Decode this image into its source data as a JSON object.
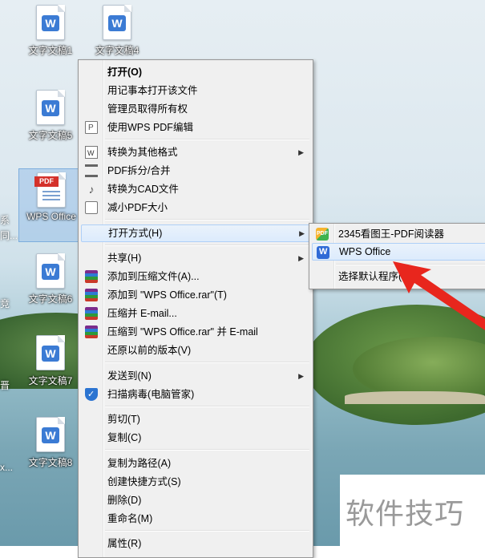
{
  "desktop": {
    "icons": [
      {
        "label": "文字文稿1"
      },
      {
        "label": "文字文稿4"
      },
      {
        "label": "文字文稿5"
      },
      {
        "label": "WPS Office"
      },
      {
        "label": "文字文稿6"
      },
      {
        "label": "文字文稿7"
      },
      {
        "label": "文字文稿8"
      }
    ],
    "edge_texts": [
      "系",
      "同...",
      "竞",
      "晋",
      "x..."
    ]
  },
  "context_menu": {
    "items": [
      {
        "label": "打开(O)",
        "bold": true
      },
      {
        "label": "用记事本打开该文件"
      },
      {
        "label": "管理员取得所有权"
      },
      {
        "label": "使用WPS PDF编辑",
        "icon": "pdf-edit-icon"
      },
      {
        "label": "转换为其他格式",
        "icon": "convert-icon",
        "submenu": true
      },
      {
        "label": "PDF拆分/合并",
        "icon": "split-merge-icon"
      },
      {
        "label": "转换为CAD文件",
        "icon": "cad-icon"
      },
      {
        "label": "减小PDF大小",
        "icon": "shrink-pdf-icon"
      },
      {
        "label": "打开方式(H)",
        "submenu": true,
        "highlighted": true
      },
      {
        "label": "共享(H)",
        "submenu": true
      },
      {
        "label": "添加到压缩文件(A)...",
        "icon": "winrar-icon"
      },
      {
        "label": "添加到 \"WPS Office.rar\"(T)",
        "icon": "winrar-icon"
      },
      {
        "label": "压缩并 E-mail...",
        "icon": "winrar-icon"
      },
      {
        "label": "压缩到 \"WPS Office.rar\" 并 E-mail",
        "icon": "winrar-icon"
      },
      {
        "label": "还原以前的版本(V)"
      },
      {
        "label": "发送到(N)",
        "submenu": true
      },
      {
        "label": "扫描病毒(电脑管家)",
        "icon": "shield-icon"
      },
      {
        "label": "剪切(T)"
      },
      {
        "label": "复制(C)"
      },
      {
        "label": "复制为路径(A)"
      },
      {
        "label": "创建快捷方式(S)"
      },
      {
        "label": "删除(D)"
      },
      {
        "label": "重命名(M)"
      },
      {
        "label": "属性(R)"
      }
    ]
  },
  "open_with_submenu": {
    "items": [
      {
        "label": "2345看图王-PDF阅读器",
        "icon": "2345-viewer-icon"
      },
      {
        "label": "WPS Office",
        "icon": "wps-icon",
        "highlighted": true
      },
      {
        "label": "选择默认程序(C)..."
      }
    ]
  },
  "icon_texts": {
    "pdf_badge": "PDF",
    "word_badge": "W",
    "app_2345": "PDF"
  },
  "watermark": {
    "text": "软件技巧"
  },
  "colors": {
    "highlight": "#dcebfc",
    "arrow": "#e8261d",
    "menu_bg": "#f0f0f0"
  }
}
